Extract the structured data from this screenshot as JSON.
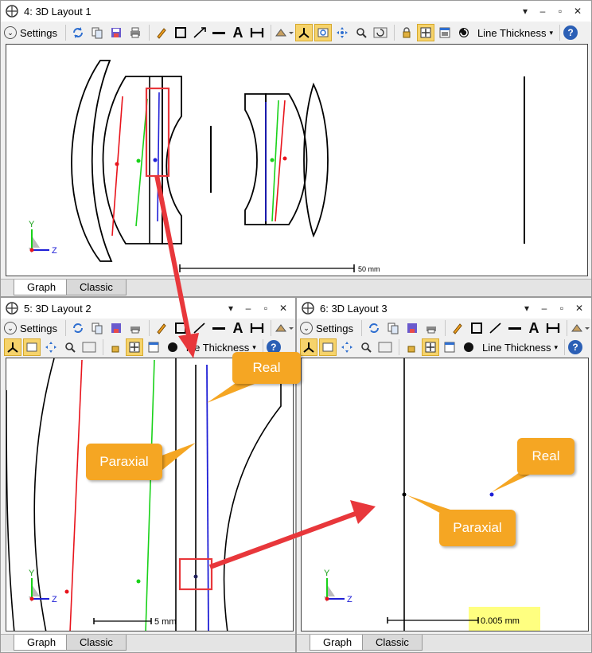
{
  "windows": {
    "layout1": {
      "title": "4: 3D Layout 1",
      "scale_label": "50 mm"
    },
    "layout2": {
      "title": "5: 3D Layout 2",
      "scale_label": "5 mm"
    },
    "layout3": {
      "title": "6: 3D Layout 3",
      "scale_label": "0.005 mm"
    }
  },
  "toolbar": {
    "settings_label": "Settings",
    "line_thickness_label": "Line Thickness",
    "line_thickness_truncated": "ine Thickness",
    "help_label": "?",
    "text_tool_label": "A"
  },
  "tabs": {
    "graph": "Graph",
    "classic": "Classic"
  },
  "axes": {
    "y_label": "Y",
    "z_label": "Z"
  },
  "callouts": {
    "real_1": "Real",
    "paraxial_1": "Paraxial",
    "real_2": "Real",
    "paraxial_2": "Paraxial"
  },
  "colors": {
    "accent": "#f5a623",
    "ray_red": "#e8141c",
    "ray_green": "#19d219",
    "ray_blue": "#1f1fd6",
    "highlight_box": "#e8373b",
    "arrow": "#e8373b",
    "scale_highlight": "#ffff80"
  },
  "icons": [
    "zemax-window-icon",
    "refresh-icon",
    "copy-icon",
    "save-icon",
    "print-icon",
    "pencil-icon",
    "rectangle-icon",
    "arrow-line-icon",
    "line-icon",
    "text-icon",
    "dimension-icon",
    "annotation-menu-icon",
    "axes-icon",
    "zoom-window-icon",
    "pan-icon",
    "zoom-icon",
    "reset-icon",
    "lock-icon",
    "fit-icon",
    "window-icon",
    "rotate-icon",
    "help-icon"
  ]
}
